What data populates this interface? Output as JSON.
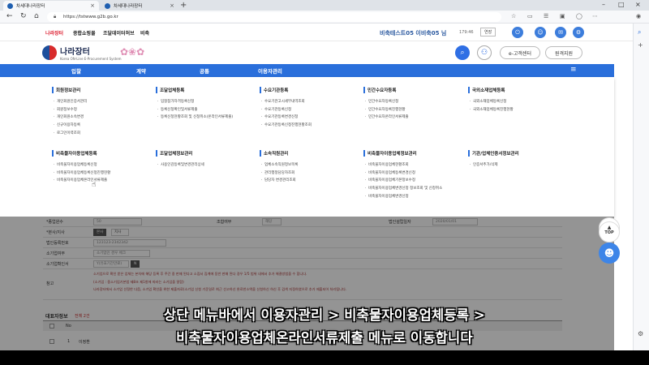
{
  "browser": {
    "tabs": [
      {
        "label": "차세대나라장터"
      },
      {
        "label": "차세대나라장터"
      }
    ],
    "url": "https://tstwww.g2b.go.kr"
  },
  "sitebar": {
    "links": [
      "나라장터",
      "종합쇼핑몰",
      "조달데이터허브",
      "비축"
    ],
    "user": "비축테스트05 이비축05 님",
    "timer": "179:46",
    "extend_label": "연장"
  },
  "header": {
    "logo_name": "나라장터",
    "logo_sub": "Korea ON-Line E-Procurement System",
    "customer_center": "e-고객센터",
    "remote_support": "원격지원"
  },
  "nav": {
    "items": [
      "입찰",
      "계약",
      "공통",
      "이용자관리"
    ]
  },
  "mega": {
    "row1": [
      {
        "title": "회원정보관리",
        "items": [
          "개인회원인증서관리",
          "회원정보수정",
          "개인회원소속변경",
          "신규이용자등록",
          "로그인이력조회"
        ]
      },
      {
        "title": "조달업체등록",
        "items": [
          "입찰참가자격등록신청",
          "등록신청확인및서류제출",
          "등록신청현황조회 및 신청취소(온라인서류제출)"
        ]
      },
      {
        "title": "수요기관등록",
        "items": [
          "수요기관고시세부내역조회",
          "수요기관등록신청",
          "수요기관등록변경신청",
          "수요기관등록신청진행현황조회"
        ]
      },
      {
        "title": "민간수요자등록",
        "items": [
          "민간수요자등록신청",
          "민간수요자등록진행현황",
          "민간수요자온라인서류제출"
        ]
      },
      {
        "title": "국외소재업체등록",
        "items": [
          "국외소재업체등록신청",
          "국외소재업체등록진행현황"
        ]
      }
    ],
    "row2": [
      {
        "title": "비축물자이용업체등록",
        "items": [
          "비축물자이용업체등록신청",
          "비축물자이용업체등록신청진행현황",
          "비축물자이용업체온라인서류제출"
        ]
      },
      {
        "title": "조달업체정보관리",
        "items": [
          "사용인감등록및변경관리상세"
        ]
      },
      {
        "title": "소속직원관리",
        "items": [
          "업체소속직원정보목록",
          "관리행정담당자조회",
          "담당자 변경관리조회"
        ]
      },
      {
        "title": "비축물자이용업체정보관리",
        "items": [
          "비축물자이용업체현황조회",
          "비축물자이용업체등록변경신청",
          "비축물자이용업체기본정보수정",
          "비축물자이용업체변경신청 정보조회 및 신청취소",
          "비축물자이용업체변경신청"
        ]
      },
      {
        "title": "기관/업체인증서정보관리",
        "items": [
          "인증서추가/삭제"
        ]
      }
    ]
  },
  "form": {
    "row1_label": "*종업원수",
    "row1_value": "50",
    "row1_mid_label": "조합여부",
    "row1_mid_btn": "해당",
    "row1_right_label": "법인설립일자",
    "row1_right_value": "2020/01/01",
    "row2_label": "*본사/지사",
    "row2_btn1": "본사",
    "row2_btn2": "지사",
    "row3_label": "법인등록번호",
    "row3_value": "123123-2342342",
    "row4_label": "소기업여부",
    "row4_value": "소기업인 경우 체크",
    "row5_label": "소기업확인서",
    "row5_value": "Y(유효기간만료)",
    "row5_btn": "N",
    "row6_label": "참고",
    "note1": "소기업으로 확인 받은 업체는 본차에 해당 등록 후 주간 중 판매 된다고 소집서 집계에 동반 판매 된다 경우 1/5 범위 내에서 추가 해결방법을 수 합니다.",
    "note2": "(소기업 : 중소기업기본법 제8조 제1항에 따라는 소기업을 말함)",
    "note3": "나라장터에서 소기업 선정한 다음, 소기업 확인을 위한 제출자료(소기업 신청 기준일로 최근 선고하신 완료한소액을 신청하신 하신 후 검색 지정하였으로 추가 제출되어 처리됩니다.",
    "rep_title": "대표자정보",
    "rep_count": "전체 2건",
    "rep_col_no": "No",
    "rep_row_no": "1",
    "rep_row_name": "이정환"
  },
  "side": {
    "top_label": "TOP"
  },
  "caption": {
    "line1": "상단 메뉴바에서 이용자관리 > 비축물자이용업체등록 >",
    "line2": "비축물자이용업체온라인서류제출 메뉴로 이동합니다"
  }
}
